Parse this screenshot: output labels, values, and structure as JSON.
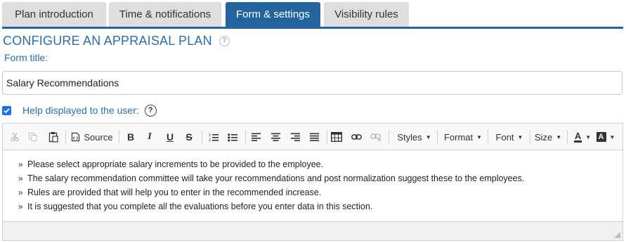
{
  "tabs": [
    {
      "label": "Plan introduction"
    },
    {
      "label": "Time & notifications"
    },
    {
      "label": "Form & settings"
    },
    {
      "label": "Visibility rules"
    }
  ],
  "active_tab": "Form & settings",
  "section": {
    "title": "CONFIGURE AN APPRAISAL PLAN",
    "help_icon": "?"
  },
  "form": {
    "title_label": "Form title:",
    "title_value": "Salary Recommendations",
    "help_label": "Help displayed to the user:",
    "help_checked": true,
    "help_icon": "?"
  },
  "toolbar": {
    "source": "Source",
    "styles": "Styles",
    "format": "Format",
    "font": "Font",
    "size": "Size",
    "bold": "B",
    "italic": "I",
    "underline": "U",
    "strike": "S",
    "text_color": "A",
    "bg_color": "A"
  },
  "editor": {
    "bullet": "»",
    "lines": [
      "Please select appropriate salary increments to be provided to the employee.",
      "The salary recommendation committee will take your recommendations and post normalization suggest these to the employees.",
      "Rules are provided that will help you to enter in the recommended increase.",
      "It is suggested that you complete all the evaluations before you enter data in this section."
    ]
  },
  "colors": {
    "accent": "#22659e",
    "label": "#2d6ea8",
    "tab_inactive": "#dedede"
  }
}
